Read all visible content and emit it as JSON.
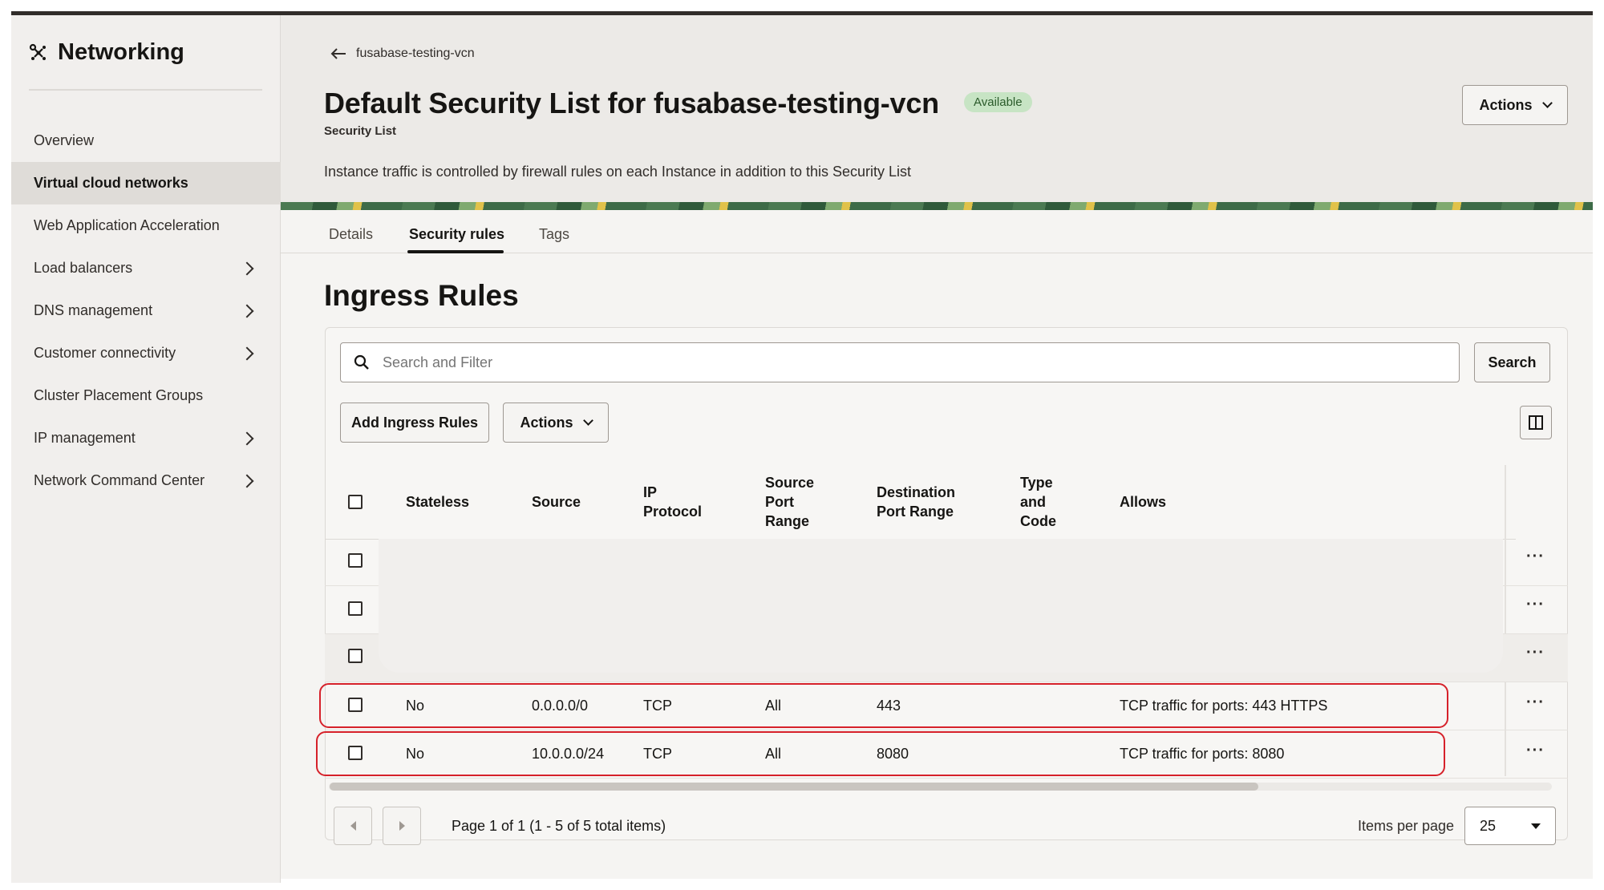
{
  "sidebar": {
    "brand": "Networking",
    "items": [
      {
        "label": "Overview"
      },
      {
        "label": "Virtual cloud networks"
      },
      {
        "label": "Web Application Acceleration"
      },
      {
        "label": "Load balancers"
      },
      {
        "label": "DNS management"
      },
      {
        "label": "Customer connectivity"
      },
      {
        "label": "Cluster Placement Groups"
      },
      {
        "label": "IP management"
      },
      {
        "label": "Network Command Center"
      }
    ]
  },
  "header": {
    "back_label": "fusabase-testing-vcn",
    "title": "Default Security List for fusabase-testing-vcn",
    "status_badge": "Available",
    "subtitle": "Security List",
    "description": "Instance traffic is controlled by firewall rules on each Instance in addition to this Security List",
    "actions_label": "Actions"
  },
  "tabs": [
    {
      "label": "Details"
    },
    {
      "label": "Security rules"
    },
    {
      "label": "Tags"
    }
  ],
  "section_title": "Ingress Rules",
  "toolbar": {
    "search_placeholder": "Search and Filter",
    "search_label": "Search",
    "add_label": "Add Ingress Rules",
    "actions_label": "Actions"
  },
  "table": {
    "columns": {
      "stateless": "Stateless",
      "source": "Source",
      "ip_protocol_1": "IP",
      "ip_protocol_2": "Protocol",
      "spr_1": "Source",
      "spr_2": "Port",
      "spr_3": "Range",
      "dpr_1": "Destination",
      "dpr_2": "Port Range",
      "tc_1": "Type",
      "tc_2": "and",
      "tc_3": "Code",
      "allows": "Allows"
    },
    "rows": [
      {
        "stateless": "",
        "source": "",
        "protocol": "",
        "spr": "",
        "dpr": "",
        "allows": ""
      },
      {
        "stateless": "",
        "source": "",
        "protocol": "",
        "spr": "",
        "dpr": "",
        "allows": ""
      },
      {
        "stateless": "",
        "source": "",
        "protocol": "",
        "spr": "",
        "dpr": "",
        "allows": ""
      },
      {
        "stateless": "No",
        "source": "0.0.0.0/0",
        "protocol": "TCP",
        "spr": "All",
        "dpr": "443",
        "allows": "TCP traffic for ports: 443 HTTPS"
      },
      {
        "stateless": "No",
        "source": "10.0.0.0/24",
        "protocol": "TCP",
        "spr": "All",
        "dpr": "8080",
        "allows": "TCP traffic for ports: 8080"
      }
    ],
    "row_actions_label": "···"
  },
  "pagination": {
    "text": "Page 1 of 1 (1 - 5 of 5 total items)",
    "items_per_page_label": "Items per page",
    "items_per_page_value": "25"
  }
}
